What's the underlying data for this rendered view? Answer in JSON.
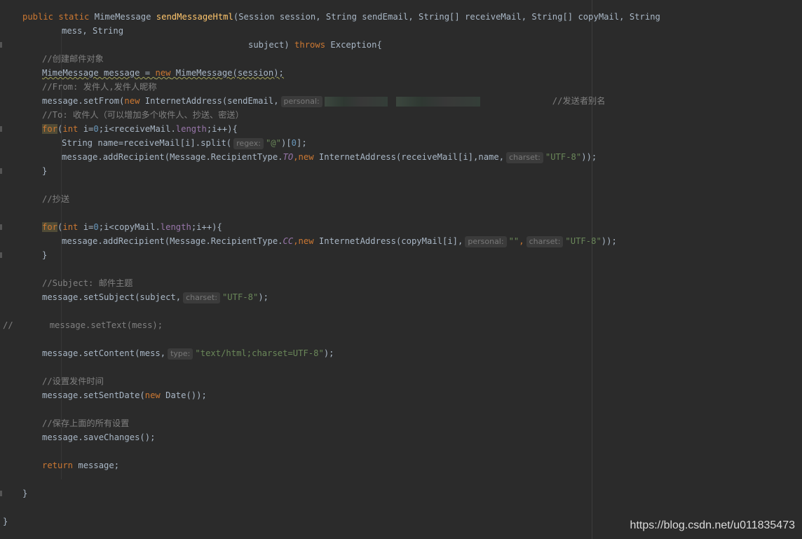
{
  "lines": {
    "l1": {
      "kw1": "public static ",
      "type": "MimeMessage ",
      "method": "sendMessageHtml",
      "params": "(Session session, String sendEmail, String[] receiveMail, String[] copyMail, String"
    },
    "l2": {
      "text": "mess, String"
    },
    "l3": {
      "pre": "subject) ",
      "kw": "throws",
      "post": " Exception{"
    },
    "l4": {
      "comment": "//创建邮件对象"
    },
    "l5": {
      "var": "MimeMessage message",
      "eq": " = ",
      "kw": "new",
      "post": " MimeMessage(session);"
    },
    "l6": {
      "comment": "//From: 发件人,发件人昵称"
    },
    "l7": {
      "pre": "message.setFrom(",
      "kw": "new",
      "post": " InternetAddress(sendEmail,",
      "hint": "personal:",
      "comment": "//发送者别名"
    },
    "l8": {
      "comment": "//To: 收件人（可以增加多个收件人、抄送、密送）"
    },
    "l9": {
      "kw": "for",
      "a": "(",
      "int": "int",
      "b": " i=",
      "zero": "0",
      "c": ";i<receiveMail.",
      "len": "length",
      "d": ";i++){"
    },
    "l10": {
      "pre": "String name=receiveMail[i].split(",
      "hint": "regex:",
      "str": "\"@\"",
      "post": ")[",
      "idx": "0",
      "end": "];"
    },
    "l11": {
      "pre": "message.addRecipient(Message.RecipientType.",
      "const": "TO",
      "comma": ",",
      "kw": "new",
      "post": " InternetAddress(receiveMail[i],name,",
      "hint": "charset:",
      "str": "\"UTF-8\"",
      "end": "));"
    },
    "l12": {
      "text": "}"
    },
    "l13": {
      "comment": "//抄送"
    },
    "l14": {
      "kw": "for",
      "a": "(",
      "int": "int",
      "b": " i=",
      "zero": "0",
      "c": ";i<copyMail.",
      "len": "length",
      "d": ";i++){"
    },
    "l15": {
      "pre": "message.addRecipient(Message.RecipientType.",
      "const": "CC",
      "comma": ",",
      "kw": "new",
      "post": " InternetAddress(copyMail[i],",
      "hint1": "personal:",
      "str1": "\"\"",
      "comma2": ",",
      "hint2": "charset:",
      "str2": "\"UTF-8\"",
      "end": "));"
    },
    "l16": {
      "text": "}"
    },
    "l17": {
      "comment": "//Subject: 邮件主题"
    },
    "l18": {
      "pre": "message.setSubject(subject,",
      "hint": "charset:",
      "str": "\"UTF-8\"",
      "end": ");"
    },
    "l19": {
      "slashes": "//",
      "text": "message.setText(mess);"
    },
    "l20": {
      "pre": "message.setContent(mess,",
      "hint": "type:",
      "str": "\"text/html;charset=UTF-8\"",
      "end": ");"
    },
    "l21": {
      "comment": "//设置发件时间"
    },
    "l22": {
      "pre": "message.setSentDate(",
      "kw": "new",
      "post": " Date());"
    },
    "l23": {
      "comment": "//保存上面的所有设置"
    },
    "l24": {
      "text": "message.saveChanges();"
    },
    "l25": {
      "kw": "return",
      "post": " message;"
    },
    "l26": {
      "text": "}"
    },
    "l27": {
      "text": "}"
    }
  },
  "watermark": "https://blog.csdn.net/u011835473",
  "colors": {
    "background": "#2b2b2b",
    "keyword": "#cc7832",
    "method": "#ffc66d",
    "comment": "#808080",
    "string": "#6a8759",
    "number": "#6897bb",
    "field": "#9876aa"
  }
}
